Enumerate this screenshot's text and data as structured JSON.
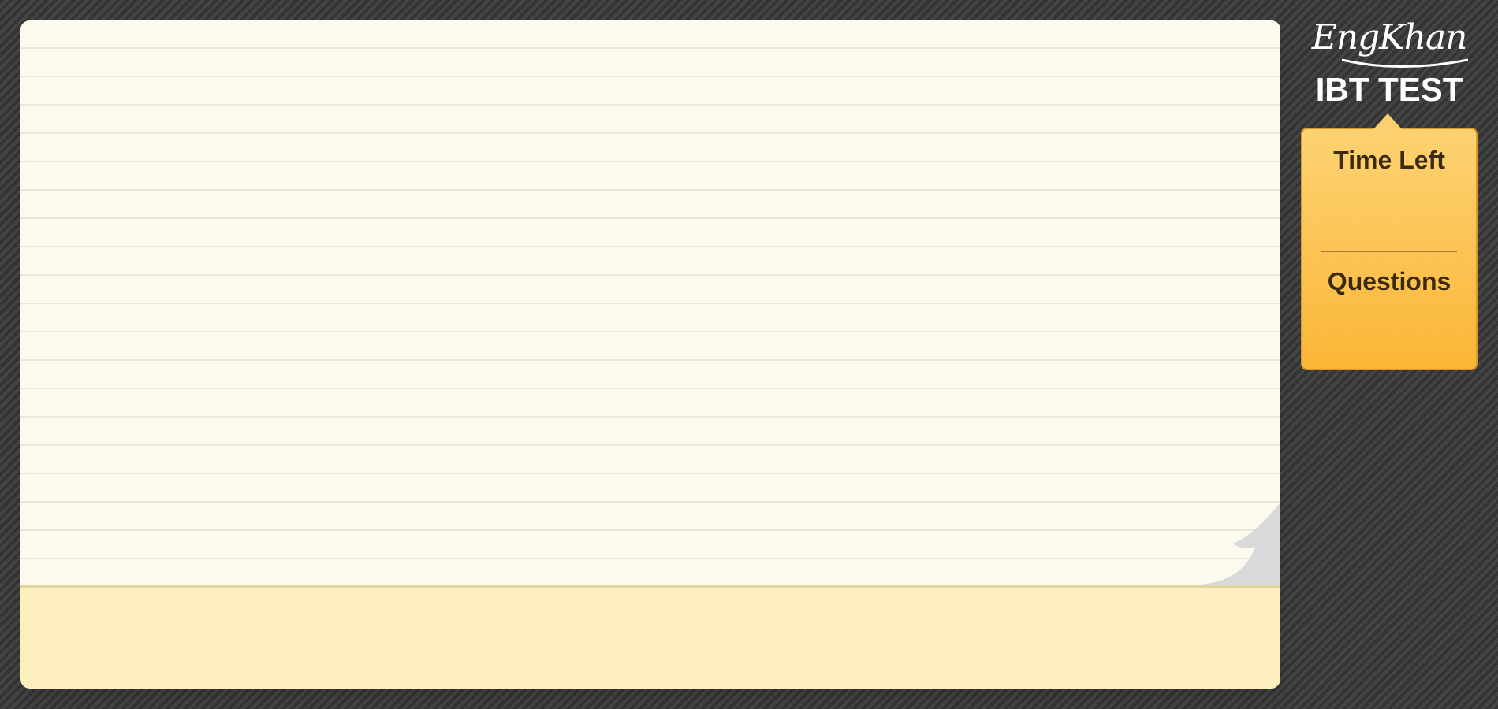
{
  "logo": "EngKhan",
  "title": "IBT TEST",
  "status_panel": {
    "time_label": "Time Left",
    "questions_label": "Questions"
  }
}
